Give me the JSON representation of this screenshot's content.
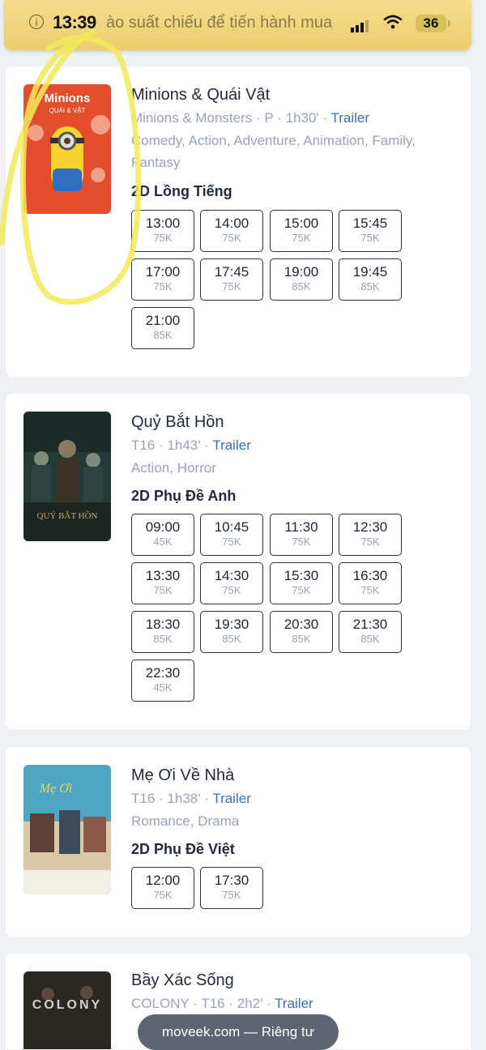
{
  "notice": {
    "time": "13:39",
    "message": "ào suất chiếu để tiến hành mua",
    "battery": "36",
    "info_icon": "info-icon",
    "colors": {
      "banner": "#f1d57e",
      "text": "#8a7a48"
    }
  },
  "movies": [
    {
      "title": "Minions & Quái Vật",
      "original_title": "Minions & Monsters",
      "rating": "P",
      "duration": "1h30'",
      "trailer": "Trailer",
      "genres": "Comedy, Action, Adventure, Animation, Family, Fantasy",
      "format": "2D Lồng Tiếng",
      "poster": {
        "top_text": "Minions",
        "sub_text": "QUÁI & VẬT",
        "color": "#e24e2b"
      },
      "showtimes": [
        {
          "time": "13:00",
          "price": "75K"
        },
        {
          "time": "14:00",
          "price": "75K"
        },
        {
          "time": "15:00",
          "price": "75K"
        },
        {
          "time": "15:45",
          "price": "75K"
        },
        {
          "time": "17:00",
          "price": "75K"
        },
        {
          "time": "17:45",
          "price": "75K"
        },
        {
          "time": "19:00",
          "price": "85K"
        },
        {
          "time": "19:45",
          "price": "85K"
        },
        {
          "time": "21:00",
          "price": "85K"
        }
      ]
    },
    {
      "title": "Quỷ Bắt Hồn",
      "rating": "T16",
      "duration": "1h43'",
      "trailer": "Trailer",
      "genres": "Action, Horror",
      "format": "2D Phụ Đề Anh",
      "poster": {
        "top_text": "QUỶ BẮT HỒN",
        "color": "#233a35"
      },
      "showtimes": [
        {
          "time": "09:00",
          "price": "45K"
        },
        {
          "time": "10:45",
          "price": "75K"
        },
        {
          "time": "11:30",
          "price": "75K"
        },
        {
          "time": "12:30",
          "price": "75K"
        },
        {
          "time": "13:30",
          "price": "75K"
        },
        {
          "time": "14:30",
          "price": "75K"
        },
        {
          "time": "15:30",
          "price": "75K"
        },
        {
          "time": "16:30",
          "price": "75K"
        },
        {
          "time": "18:30",
          "price": "85K"
        },
        {
          "time": "19:30",
          "price": "85K"
        },
        {
          "time": "20:30",
          "price": "85K"
        },
        {
          "time": "21:30",
          "price": "85K"
        },
        {
          "time": "22:30",
          "price": "45K"
        }
      ]
    },
    {
      "title": "Mẹ Ơi Về Nhà",
      "rating": "T16",
      "duration": "1h38'",
      "trailer": "Trailer",
      "genres": "Romance, Drama",
      "format": "2D Phụ Đề Việt",
      "poster": {
        "top_text": "Mẹ Ơi",
        "color": "#4fa6c4"
      },
      "showtimes": [
        {
          "time": "12:00",
          "price": "75K"
        },
        {
          "time": "17:30",
          "price": "75K"
        }
      ]
    },
    {
      "title": "Bầy Xác Sống",
      "original_title": "COLONY",
      "rating": "T16",
      "duration": "2h2'",
      "trailer": "Trailer",
      "poster": {
        "top_text": "COLONY",
        "color": "#2b2723"
      }
    }
  ],
  "url_bar": {
    "text": "moveek.com — Riêng tư"
  }
}
